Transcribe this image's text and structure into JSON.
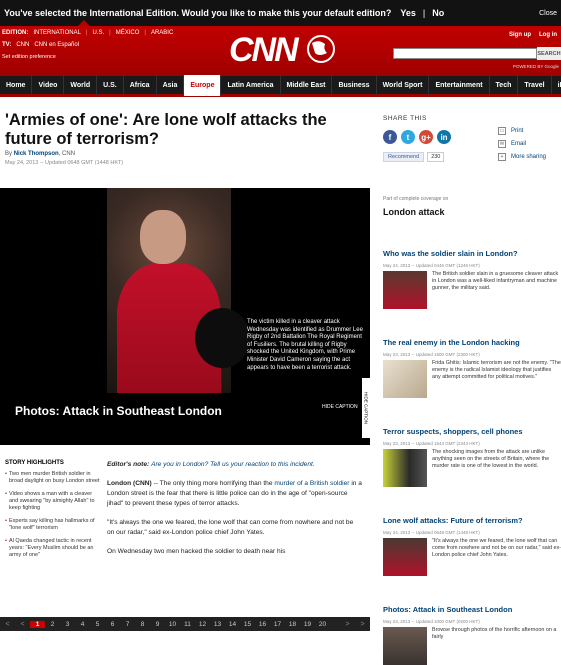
{
  "topbar": {
    "question": "You've selected the International Edition. Would you like to make this your default edition?",
    "yes": "Yes",
    "sep": "|",
    "no": "No",
    "close": "Close"
  },
  "header": {
    "edition_label": "EDITION:",
    "edition": "INTERNATIONAL",
    "editions": [
      "U.S.",
      "MÉXICO",
      "ARABIC"
    ],
    "tv_label": "TV:",
    "tv": [
      "CNN",
      "CNN en Español"
    ],
    "pref": "Set edition preference",
    "sign_up": "Sign up",
    "log_in": "Log in",
    "search_btn": "SEARCH",
    "powered": "POWERED BY Google",
    "logo": "CNN"
  },
  "nav": [
    "Home",
    "Video",
    "World",
    "U.S.",
    "Africa",
    "Asia",
    "Europe",
    "Latin America",
    "Middle East",
    "Business",
    "World Sport",
    "Entertainment",
    "Tech",
    "Travel",
    "iReport"
  ],
  "article": {
    "title": "'Armies of one': Are lone wolf attacks the future of terrorism?",
    "by": "By",
    "author": "Nick Thompson",
    "org": ", CNN",
    "date": "May 24, 2013 -- Updated 0648 GMT (1448 HKT)"
  },
  "share": {
    "label": "SHARE THIS",
    "recommend": "Recommend",
    "count": "230"
  },
  "tools": {
    "print": "Print",
    "email": "Email",
    "more": "More sharing"
  },
  "gallery": {
    "caption": "The victim killed in a cleaver attack Wednesday was identified as Drummer Lee Rigby of 2nd Battalion The Royal Regiment of Fusiliers. The brutal killing of Rigby shocked the United Kingdom, with Prime Minister David Cameron saying the act appears to have been a terrorist attack.",
    "title": "Photos: Attack in Southeast London",
    "hide": "HIDE CAPTION",
    "vlabel": "HIDE CAPTION",
    "pages": [
      "1",
      "2",
      "3",
      "4",
      "5",
      "6",
      "7",
      "8",
      "9",
      "10",
      "11",
      "12",
      "13",
      "14",
      "15",
      "16",
      "17",
      "18",
      "19",
      "20"
    ],
    "prev": "<",
    "next": ">"
  },
  "highlights": {
    "head": "STORY HIGHLIGHTS",
    "items": [
      "Two men murder British soldier in broad daylight on busy London street",
      "Video shows a man with a cleaver and swearing \"by almighty Allah\" to keep fighting",
      "Experts say killing has hallmarks of \"lone wolf\" terrorism",
      "Al Qaeda changed tactic in recent years: \"Every Muslim should be an army of one\""
    ]
  },
  "body": {
    "note_label": "Editor's note:",
    "note_link": "Are you in London? Tell us your reaction to this incident.",
    "p1_a": "London (CNN)",
    "p1_b": " -- The only thing more horrifying than the ",
    "p1_link": "murder of a British soldier",
    "p1_c": " in a London street is the fear that there is little police can do in the age of \"open-source jihad\" to prevent these types of terror attacks.",
    "p2": "\"It's always the one we feared, the lone wolf that can come from nowhere and not be on our radar,\" said ex-London police chief John Yates.",
    "p3": "On Wednesday two men hacked the soldier to death near his"
  },
  "rail": {
    "part": "Part of complete coverage on",
    "heading": "London attack",
    "stories": [
      {
        "title": "Who was the soldier slain in London?",
        "date": "May 24, 2013 -- Updated 0446 GMT (1246 HKT)",
        "desc": "The British soldier slain in a gruesome cleaver attack in London was a well-liked infantryman and machine gunner, the military said."
      },
      {
        "title": "The real enemy in the London hacking",
        "date": "May 23, 2013 -- Updated 1500 GMT (2300 HKT)",
        "desc": "Frida Ghitis: Islamic terrorism are not the enemy. \"The enemy is the radical Islamist ideology that justifies any attempt committed for political motives.\""
      },
      {
        "title": "Terror suspects, shoppers, cell phones",
        "date": "May 23, 2013 -- Updated 1543 GMT (2343 HKT)",
        "desc": "The shocking images from the attack are unlike anything seen on the streets of Britain, where the murder rate is one of the lowest in the world."
      },
      {
        "title": "Lone wolf attacks: Future of terrorism?",
        "date": "May 24, 2013 -- Updated 0648 GMT (1448 HKT)",
        "desc": "\"It's always the one we feared, the lone wolf that can come from nowhere and not be on our radar,\" said ex-London police chief John Yates."
      },
      {
        "title": "Photos: Attack in Southeast London",
        "date": "May 23, 2013 -- Updated 1000 GMT (0200 HKT)",
        "desc": "Browse through photos of the horrific afternoon on a fairly"
      }
    ]
  },
  "colors": {
    "cnn_red": "#c00",
    "link": "#004276"
  }
}
